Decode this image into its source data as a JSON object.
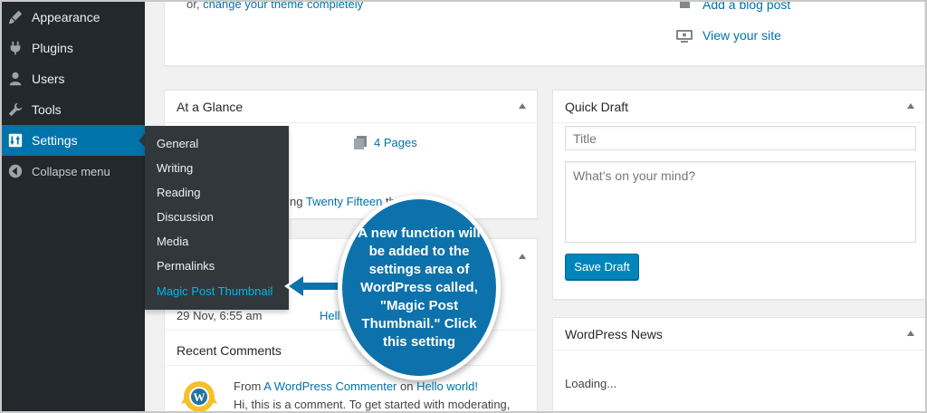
{
  "sidebar": {
    "items": [
      {
        "label": "Appearance",
        "icon": "paintbrush-icon"
      },
      {
        "label": "Plugins",
        "icon": "plug-icon"
      },
      {
        "label": "Users",
        "icon": "users-icon"
      },
      {
        "label": "Tools",
        "icon": "wrench-icon"
      },
      {
        "label": "Settings",
        "icon": "settings-icon"
      }
    ],
    "collapse_label": "Collapse menu"
  },
  "settings_submenu": [
    "General",
    "Writing",
    "Reading",
    "Discussion",
    "Media",
    "Permalinks",
    "Magic Post Thumbnail"
  ],
  "top_panel": {
    "theme_text_prefix": "or, ",
    "theme_link": "change your theme completely",
    "add_post_link": "Add a blog post",
    "view_site_link": "View your site"
  },
  "at_a_glance": {
    "title": "At a Glance",
    "pages_count": "4 Pages",
    "theme_prefix": "ng ",
    "theme_link": "Twenty Fifteen",
    "theme_suffix": " th"
  },
  "activity": {
    "date": "29 Nov, 6:55 am",
    "post_link": "Hell",
    "recent_comments": "Recent Comments",
    "comment_from": "From ",
    "commenter": "A WordPress Commenter",
    "on": " on ",
    "post": "Hello world!",
    "comment_text": "Hi, this is a comment. To get started with moderating,"
  },
  "quick_draft": {
    "title": "Quick Draft",
    "title_placeholder": "Title",
    "content_placeholder": "What’s on your mind?",
    "save_label": "Save Draft"
  },
  "wordpress_news": {
    "title": "WordPress News",
    "loading": "Loading..."
  },
  "callout": {
    "text": "A new function will be added to the settings area of WordPress called, \"Magic Post Thumbnail.\" Click this setting"
  },
  "colors": {
    "sidebar_bg": "#23282d",
    "active_bg": "#0073aa",
    "flyout_bg": "#32373c",
    "link": "#0073aa",
    "callout_bg": "#0d72ab"
  }
}
